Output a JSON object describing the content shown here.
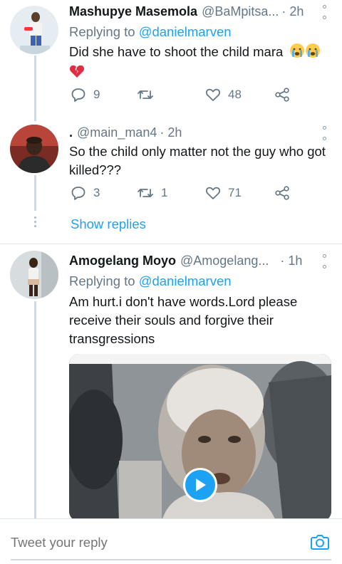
{
  "tweets": [
    {
      "display_name": "Mashupye Masemola",
      "handle": "@BaMpitsa...",
      "time": "· 2h",
      "replying_label": "Replying to",
      "replying_to": "@danielmarven",
      "text": "Did she have to shoot the child mara",
      "emojis": [
        "crying-face",
        "crying-face",
        "broken-heart"
      ],
      "replies": "9",
      "retweets": "",
      "likes": "48"
    },
    {
      "display_name": ".",
      "handle": "@main_man4",
      "time": "· 2h",
      "text": "So the child only matter not the guy who got killed???",
      "replies": "3",
      "retweets": "1",
      "likes": "71",
      "show_replies": "Show replies"
    },
    {
      "display_name": "Amogelang Moyo",
      "handle": "@Amogelang...",
      "time": "· 1h",
      "replying_label": "Replying to",
      "replying_to": "@danielmarven",
      "text": "Am hurt.i don't have words.Lord please receive their souls and forgive their transgressions",
      "media": "video"
    }
  ],
  "compose": {
    "placeholder": "Tweet your reply"
  },
  "colors": {
    "accent": "#1da1f2",
    "secondary_text": "#657786",
    "divider": "#e1e8ed"
  }
}
